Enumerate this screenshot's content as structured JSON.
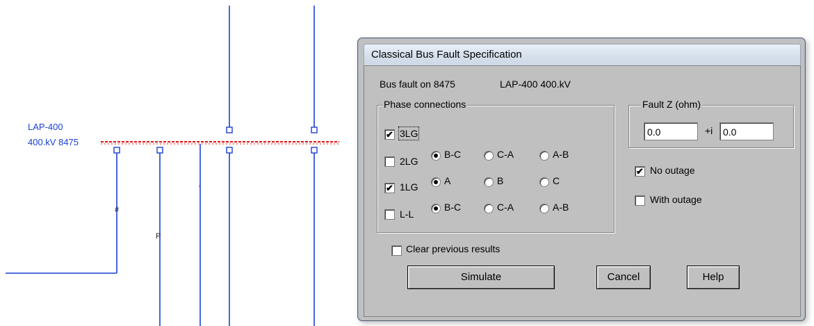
{
  "diagram": {
    "bus_name": "LAP-400",
    "bus_id_label": "400.kV 8475",
    "glyph_a": "#",
    "glyph_p": "P",
    "glyph_s": "·",
    "colors": {
      "line": "#1a3fd6",
      "fault": "#e01010"
    }
  },
  "dialog": {
    "title": "Classical Bus Fault Specification",
    "bus_fault_text": "Bus fault on 8475",
    "bus_fault_name": "LAP-400  400.kV",
    "phase_group_label": "Phase connections",
    "rows": [
      {
        "label": "3LG",
        "checked": true,
        "options": []
      },
      {
        "label": "2LG",
        "checked": false,
        "options": [
          "B-C",
          "C-A",
          "A-B"
        ],
        "selected": 0
      },
      {
        "label": "1LG",
        "checked": true,
        "options": [
          "A",
          "B",
          "C"
        ],
        "selected": 0
      },
      {
        "label": "L-L",
        "checked": false,
        "options": [
          "B-C",
          "C-A",
          "A-B"
        ],
        "selected": 0
      }
    ],
    "fault_z_label": "Fault Z (ohm)",
    "fault_z_real": "0.0",
    "fault_z_imag_sep": "+i",
    "fault_z_imag": "0.0",
    "no_outage_label": "No outage",
    "no_outage_checked": true,
    "with_outage_label": "With outage",
    "with_outage_checked": false,
    "clear_label": "Clear previous results",
    "clear_checked": false,
    "simulate_label": "Simulate",
    "cancel_label": "Cancel",
    "help_label": "Help"
  }
}
